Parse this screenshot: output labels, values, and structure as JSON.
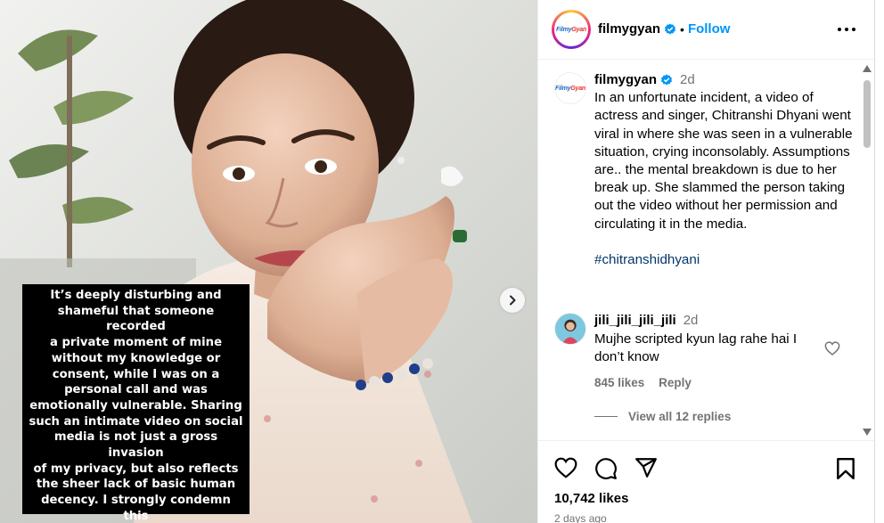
{
  "media": {
    "overlay_caption": "It’s deeply disturbing and\nshameful that someone recorded\na private moment of mine\nwithout my knowledge or\nconsent, while I was on a\npersonal call and was\nemotionally vulnerable. Sharing\nsuch an intimate video on social\nmedia is not just a gross invasion\nof my privacy, but also reflects\nthe sheer lack of basic human\ndecency. I strongly condemn this\nbehavior and urge people to\nrespect boundaries."
  },
  "header": {
    "username": "filmygyan",
    "follow_label": "Follow",
    "dot": "•",
    "logo_part1": "Filmy",
    "logo_part2": "Gyan"
  },
  "caption": {
    "username": "filmygyan",
    "time": "2d",
    "text": "In an unfortunate incident, a video of actress and singer, Chitranshi Dhyani went viral in where she was seen in a vulnerable situation, crying inconsolably. Assumptions are.. the mental breakdown is due to her break up. She slammed the person taking out the video without her permission and circulating it in the media.",
    "hashtag": "#chitranshidhyani"
  },
  "comment": {
    "username": "jili_jili_jili_jili",
    "time": "2d",
    "text": "Mujhe scripted kyun lag rahe hai I don’t know",
    "likes": "845 likes",
    "reply_label": "Reply",
    "view_replies": "View all 12 replies"
  },
  "footer": {
    "likes": "10,742 likes",
    "date": "2 days ago"
  },
  "colors": {
    "link_blue": "#0095f6",
    "hashtag_blue": "#00376b",
    "muted": "#737373",
    "verified": "#0095f6"
  },
  "icons": [
    "more-icon",
    "verified-icon",
    "heart-icon",
    "comment-icon",
    "share-icon",
    "bookmark-icon",
    "chevron-right-icon",
    "scroll-up-icon",
    "scroll-down-icon"
  ]
}
